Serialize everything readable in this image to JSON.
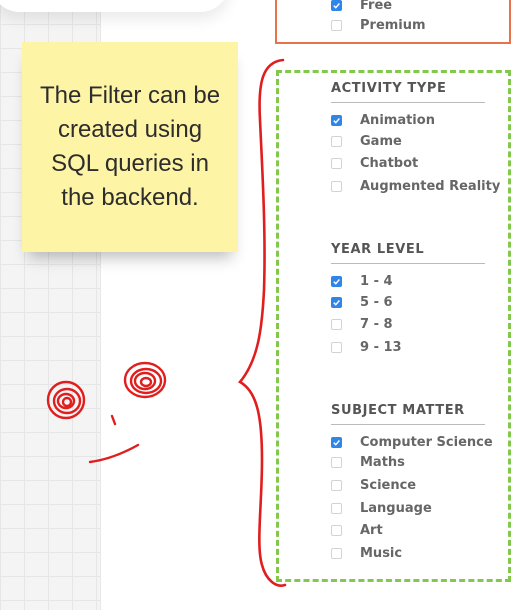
{
  "sticky_note": {
    "text": "The Filter can be created using SQL queries in the backend.",
    "background": "#fdf4a6"
  },
  "top_filter": {
    "options": [
      {
        "label": "Free",
        "checked": true
      },
      {
        "label": "Premium",
        "checked": false
      }
    ],
    "border_color": "#e8724b"
  },
  "filter_box": {
    "border_color": "#82c84a",
    "sections": [
      {
        "title": "ACTIVITY TYPE",
        "options": [
          {
            "label": "Animation",
            "checked": true
          },
          {
            "label": "Game",
            "checked": false
          },
          {
            "label": "Chatbot",
            "checked": false
          },
          {
            "label": "Augmented Reality",
            "checked": false
          }
        ]
      },
      {
        "title": "YEAR LEVEL",
        "options": [
          {
            "label": "1 - 4",
            "checked": true
          },
          {
            "label": "5 - 6",
            "checked": true
          },
          {
            "label": "7 - 8",
            "checked": false
          },
          {
            "label": "9 - 13",
            "checked": false
          }
        ]
      },
      {
        "title": "SUBJECT MATTER",
        "options": [
          {
            "label": "Computer Science",
            "checked": true
          },
          {
            "label": "Maths",
            "checked": false
          },
          {
            "label": "Science",
            "checked": false
          },
          {
            "label": "Language",
            "checked": false
          },
          {
            "label": "Art",
            "checked": false
          },
          {
            "label": "Music",
            "checked": false
          }
        ]
      }
    ]
  },
  "colors": {
    "checkbox_checked": "#2f86e8",
    "annotation_ink": "#e01e1e"
  }
}
